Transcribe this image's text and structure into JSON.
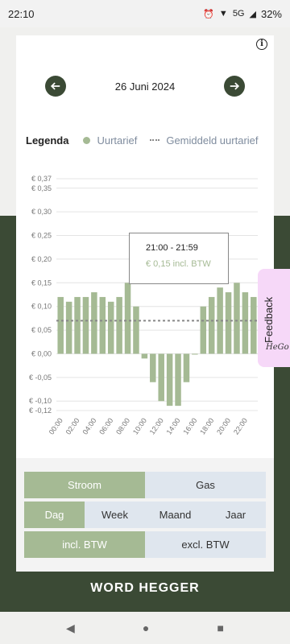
{
  "status_bar": {
    "time": "22:10",
    "network": "5G",
    "battery": "32%"
  },
  "header": {
    "date": "26 Juni 2024",
    "prev_icon": "arrow-left-icon",
    "next_icon": "arrow-right-icon",
    "info_icon": "info-icon"
  },
  "legend": {
    "title": "Legenda",
    "series_label": "Uurtarief",
    "avg_label": "Gemiddeld uurtarief"
  },
  "tooltip": {
    "time_range": "21:00 - 21:59",
    "price": "€ 0,15 incl. BTW"
  },
  "chart_data": {
    "type": "bar",
    "x_tick_labels": [
      "00:00",
      "02:00",
      "04:00",
      "06:00",
      "08:00",
      "10:00",
      "12:00",
      "14:00",
      "16:00",
      "18:00",
      "20:00",
      "22:00"
    ],
    "y_tick_labels": [
      "€ 0,37",
      "€ 0,35",
      "€ 0,30",
      "€ 0,25",
      "€ 0,20",
      "€ 0,15",
      "€ 0,10",
      "€ 0,05",
      "€ 0,00",
      "€ -0,05",
      "€ -0,10",
      "€ -0,12"
    ],
    "y_ticks": [
      0.37,
      0.35,
      0.3,
      0.25,
      0.2,
      0.15,
      0.1,
      0.05,
      0.0,
      -0.05,
      -0.1,
      -0.12
    ],
    "ylim": [
      -0.12,
      0.37
    ],
    "hours": [
      0,
      1,
      2,
      3,
      4,
      5,
      6,
      7,
      8,
      9,
      10,
      11,
      12,
      13,
      14,
      15,
      16,
      17,
      18,
      19,
      20,
      21,
      22,
      23
    ],
    "values": [
      0.12,
      0.11,
      0.12,
      0.12,
      0.13,
      0.12,
      0.11,
      0.12,
      0.15,
      0.1,
      -0.01,
      -0.06,
      -0.1,
      -0.11,
      -0.11,
      -0.06,
      0.0,
      0.1,
      0.12,
      0.14,
      0.13,
      0.15,
      0.13,
      0.12
    ],
    "average": 0.07,
    "bar_color": "#a5ba94",
    "avg_line_color": "#888888"
  },
  "controls": {
    "energy": [
      {
        "label": "Stroom",
        "active": true
      },
      {
        "label": "Gas",
        "active": false
      }
    ],
    "period": [
      {
        "label": "Dag",
        "active": true
      },
      {
        "label": "Week",
        "active": false
      },
      {
        "label": "Maand",
        "active": false
      },
      {
        "label": "Jaar",
        "active": false
      }
    ],
    "vat": [
      {
        "label": "incl. BTW",
        "active": true
      },
      {
        "label": "excl. BTW",
        "active": false
      }
    ]
  },
  "feedback": {
    "label": "Feedback",
    "logo": "HeGo"
  },
  "brand": "WORD HEGGER",
  "colors": {
    "accent_dark": "#3b4a35",
    "accent_green": "#a5ba94",
    "inactive_segment": "#dfe6ee",
    "feedback_bg": "#f6d8f8"
  }
}
